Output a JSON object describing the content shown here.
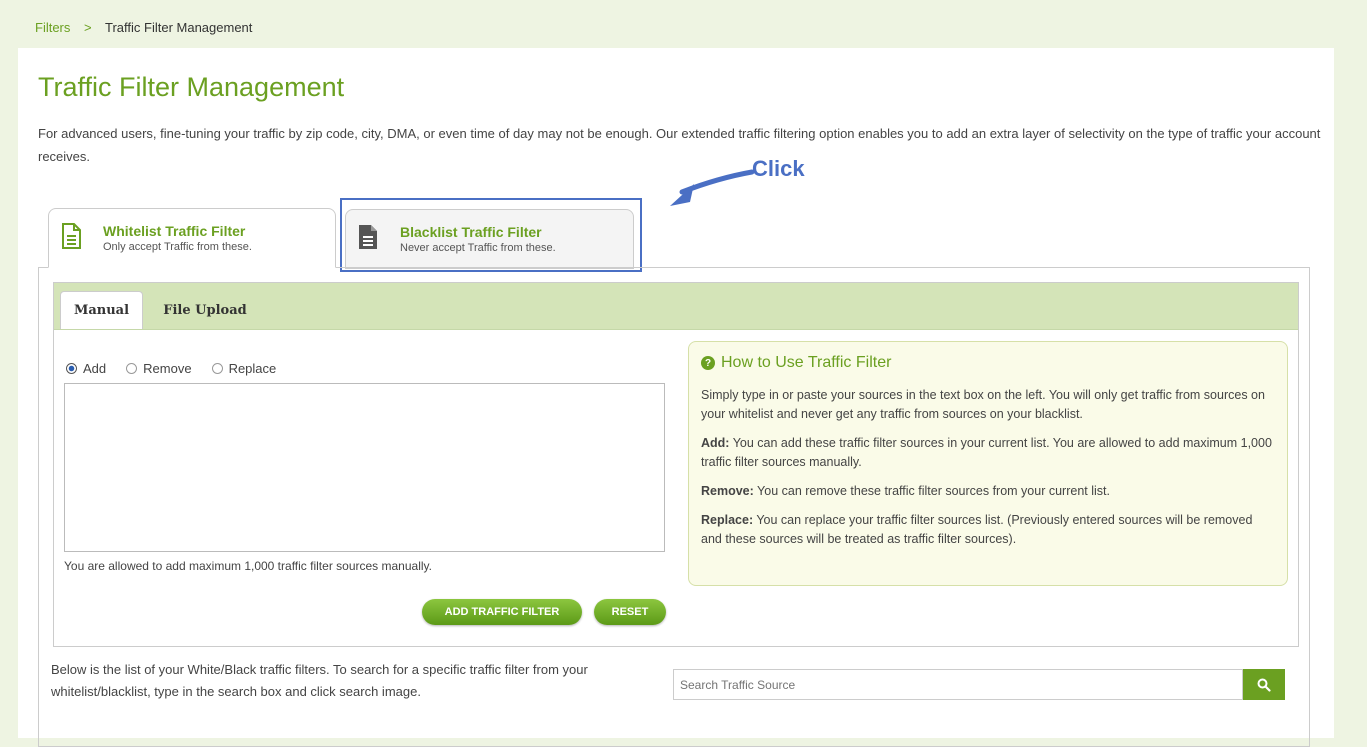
{
  "breadcrumb": {
    "parent": "Filters",
    "separator": ">",
    "current": "Traffic Filter Management"
  },
  "page": {
    "title": "Traffic Filter Management",
    "intro": "For advanced users, fine-tuning your traffic by zip code, city, DMA, or even time of day may not be enough. Our extended traffic filtering option enables you to add an extra layer of selectivity on the type of traffic your account receives."
  },
  "annotation": {
    "label": "Click",
    "color": "#4a6fc4"
  },
  "filter_tabs": [
    {
      "title": "Whitelist Traffic Filter",
      "subtitle": "Only accept Traffic from these.",
      "icon": "document-outline-icon",
      "active": true
    },
    {
      "title": "Blacklist Traffic Filter",
      "subtitle": "Never accept Traffic from these.",
      "icon": "document-filled-icon",
      "active": false
    }
  ],
  "inner_tabs": [
    {
      "label": "Manual",
      "active": true
    },
    {
      "label": "File Upload",
      "active": false
    }
  ],
  "mode_options": [
    {
      "label": "Add",
      "checked": true
    },
    {
      "label": "Remove",
      "checked": false
    },
    {
      "label": "Replace",
      "checked": false
    }
  ],
  "sources_textarea": {
    "value": "",
    "note": "You are allowed to add maximum 1,000 traffic filter sources manually."
  },
  "buttons": {
    "add": "ADD TRAFFIC FILTER",
    "reset": "RESET"
  },
  "howto": {
    "title": "How to Use Traffic Filter",
    "intro": "Simply type in or paste your sources in the text box on the left. You will only get traffic from sources on your whitelist and never get any traffic from sources on your blacklist.",
    "add_label": "Add:",
    "add_text": "You can add these traffic filter sources in your current list. You are allowed to add maximum 1,000 traffic filter sources manually.",
    "remove_label": "Remove:",
    "remove_text": "You can remove these traffic filter sources from your current list.",
    "replace_label": "Replace:",
    "replace_text": "You can replace your traffic filter sources list. (Previously entered sources will be removed and these sources will be treated as traffic filter sources)."
  },
  "list_section": {
    "text": "Below is the list of your White/Black traffic filters. To search for a specific traffic filter from your whitelist/blacklist, type in the search box and click search image.",
    "search_placeholder": "Search Traffic Source"
  },
  "colors": {
    "accent": "#6ba021",
    "background": "#eef4e2",
    "tabbar": "#d4e4b8",
    "annotation": "#4a6fc4"
  }
}
